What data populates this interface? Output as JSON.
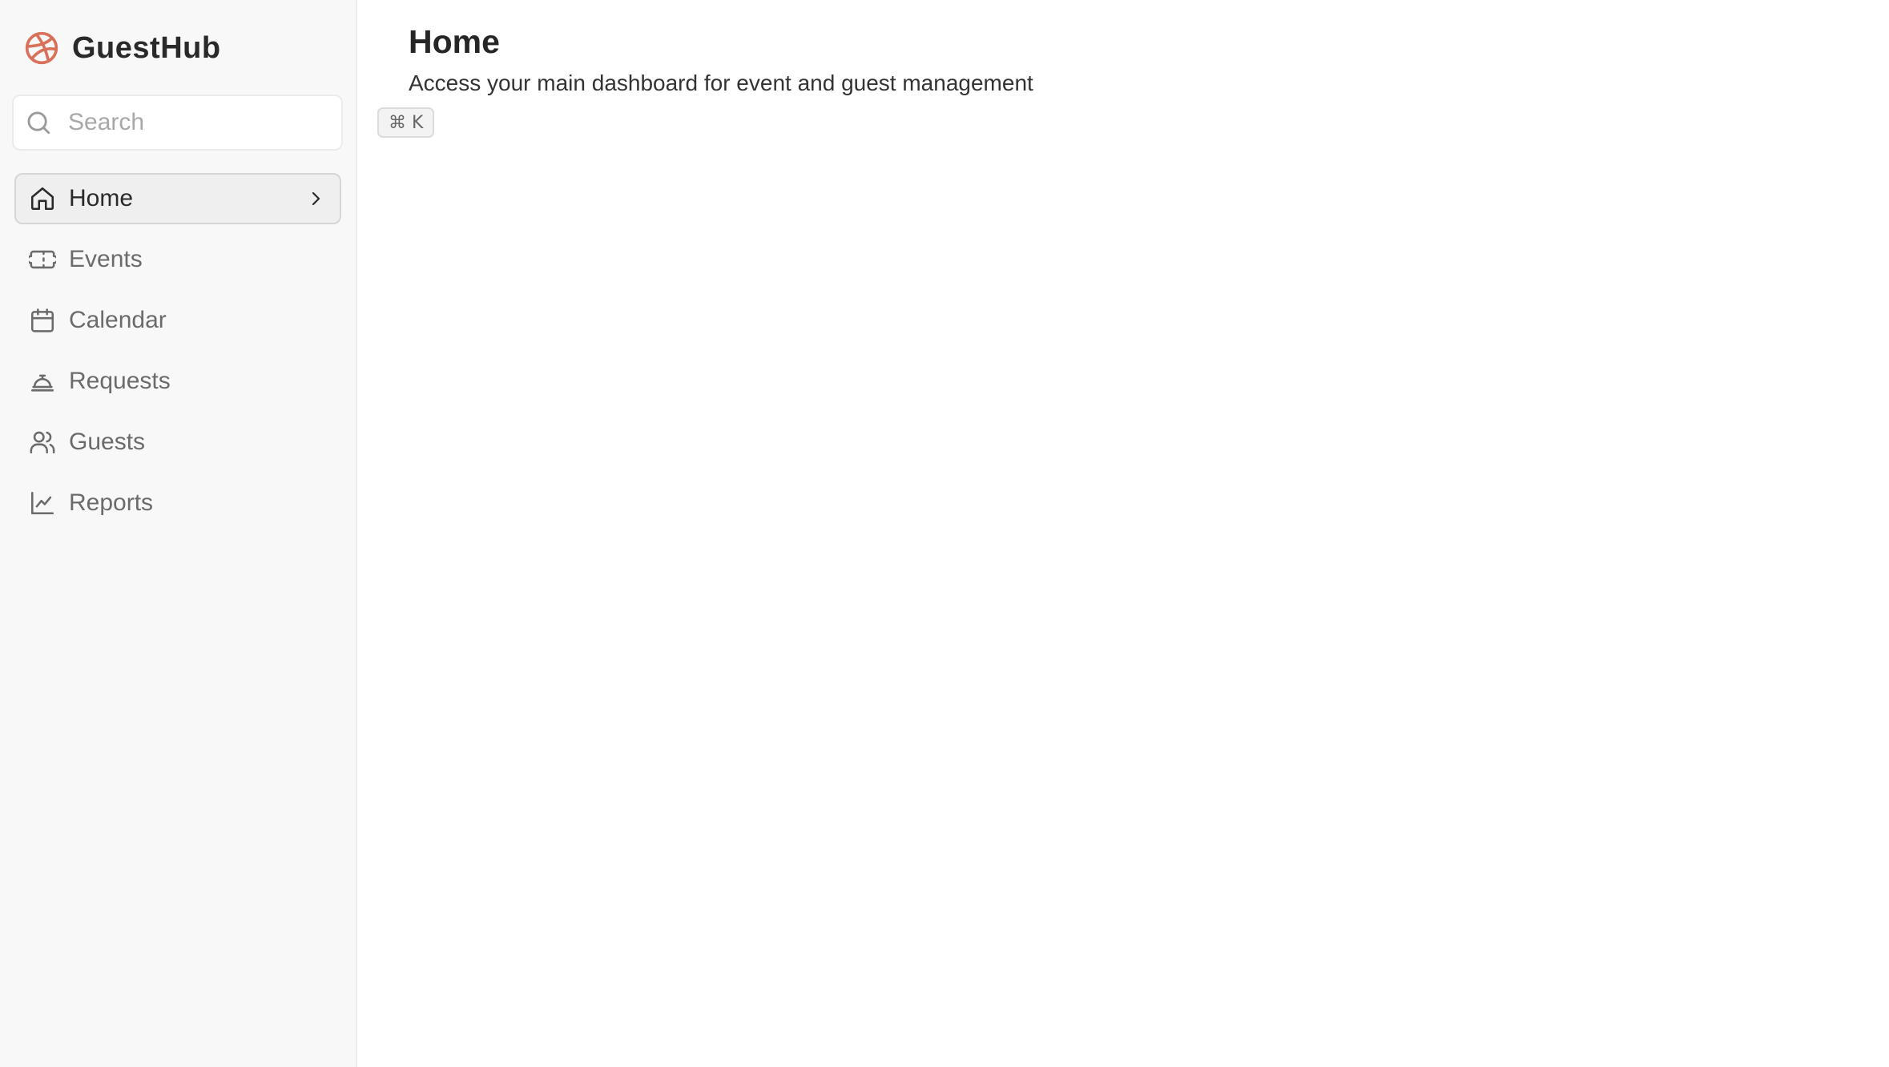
{
  "app": {
    "name": "GuestHub",
    "logo_icon": "dribbble-ball-icon",
    "accent_color": "#d9705a"
  },
  "search": {
    "placeholder": "Search",
    "value": "",
    "shortcut": "⌘ K"
  },
  "sidebar": {
    "items": [
      {
        "label": "Home",
        "icon": "home-icon",
        "active": true
      },
      {
        "label": "Events",
        "icon": "ticket-icon",
        "active": false
      },
      {
        "label": "Calendar",
        "icon": "calendar-icon",
        "active": false
      },
      {
        "label": "Requests",
        "icon": "concierge-bell-icon",
        "active": false
      },
      {
        "label": "Guests",
        "icon": "users-icon",
        "active": false
      },
      {
        "label": "Reports",
        "icon": "line-chart-icon",
        "active": false
      }
    ]
  },
  "main": {
    "title": "Home",
    "subtitle": "Access your main dashboard for event and guest management"
  }
}
